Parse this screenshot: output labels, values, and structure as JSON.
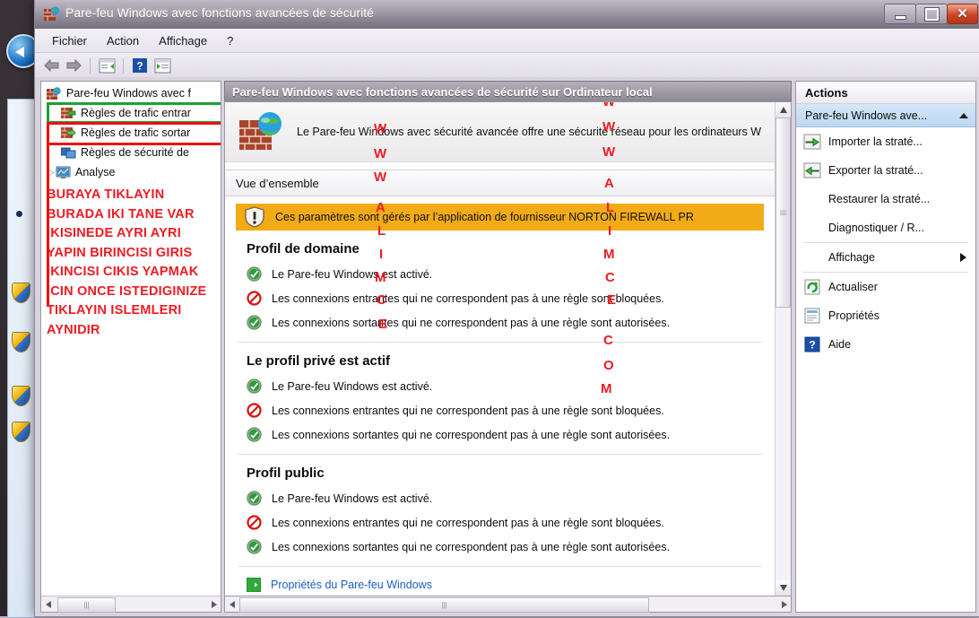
{
  "window": {
    "title": "Pare-feu Windows avec fonctions avancées de sécurité",
    "icon": "firewall-icon",
    "buttons": {
      "minimize": "–",
      "maximize": "□",
      "close": "✕"
    }
  },
  "menubar": {
    "items": [
      "Fichier",
      "Action",
      "Affichage",
      "?"
    ]
  },
  "toolbar": {
    "items": [
      {
        "name": "back-arrow-icon"
      },
      {
        "name": "forward-arrow-icon"
      },
      {
        "name": "show-hide-tree-icon"
      },
      {
        "name": "help-icon"
      },
      {
        "name": "show-hide-actions-icon"
      }
    ]
  },
  "tree": {
    "root": "Pare-feu Windows avec f",
    "items": [
      {
        "label": "Règles de trafic entrar",
        "icon": "inbound-rules-icon",
        "highlight": "green"
      },
      {
        "label": "Règles de trafic sortar",
        "icon": "outbound-rules-icon",
        "highlight": "red"
      },
      {
        "label": "Règles de sécurité de",
        "icon": "connection-security-icon",
        "highlight": "none"
      },
      {
        "label": "Analyse",
        "icon": "monitoring-icon",
        "highlight": "none",
        "expandable": true
      }
    ]
  },
  "annotation": {
    "color": "#ee1c23",
    "lines": [
      "BURAYA TIKLAYIN",
      "BURADA IKI TANE VAR",
      "IKISINEDE AYRI AYRI",
      "YAPIN BIRINCISI GIRIS",
      "IKINCISI CIKIS YAPMAK",
      "ICIN ONCE ISTEDIGINIZE",
      "TIKLAYIN ISLEMLERI",
      "AYNIDIR"
    ]
  },
  "watermark": {
    "color": "#ee1c23",
    "left_column": [
      "W",
      "W",
      "W",
      "A",
      "L",
      "I",
      "M",
      "C",
      "E"
    ],
    "right_column": [
      "W",
      "W",
      "W",
      "A",
      "L",
      "I",
      "M",
      "C",
      "E",
      "C",
      "O",
      "M"
    ]
  },
  "center": {
    "title": "Pare-feu Windows avec fonctions avancées de sécurité sur Ordinateur local",
    "banner_text": "Le Pare-feu Windows avec sécurité avancée offre une sécurité réseau pour les ordinateurs W",
    "banner_icon": "firewall-globe-icon",
    "overview_header": "Vue d’ensemble",
    "warning_icon": "warning-shield-icon",
    "warning_text": "Ces paramètres sont gérés par l’application de fournisseur NORTON FIREWALL PR",
    "profiles": [
      {
        "heading": "Profil de domaine",
        "rows": [
          {
            "icon": "check-icon",
            "text": "Le Pare-feu Windows est activé."
          },
          {
            "icon": "blocked-icon",
            "text": "Les connexions entrantes qui ne correspondent pas à une règle sont bloquées."
          },
          {
            "icon": "check-icon",
            "text": "Les connexions sortantes qui ne correspondent pas à une règle sont autorisées."
          }
        ]
      },
      {
        "heading": "Le profil privé est actif",
        "rows": [
          {
            "icon": "check-icon",
            "text": "Le Pare-feu Windows est activé."
          },
          {
            "icon": "blocked-icon",
            "text": "Les connexions entrantes qui ne correspondent pas à une règle sont bloquées."
          },
          {
            "icon": "check-icon",
            "text": "Les connexions sortantes qui ne correspondent pas à une règle sont autorisées."
          }
        ]
      },
      {
        "heading": "Profil public",
        "rows": [
          {
            "icon": "check-icon",
            "text": "Le Pare-feu Windows est activé."
          },
          {
            "icon": "blocked-icon",
            "text": "Les connexions entrantes qui ne correspondent pas à une règle sont bloquées."
          },
          {
            "icon": "check-icon",
            "text": "Les connexions sortantes qui ne correspondent pas à une règle sont autorisées."
          }
        ]
      }
    ],
    "link": {
      "icon": "properties-arrow-icon",
      "label": "Propriétés du Pare-feu Windows"
    }
  },
  "actions": {
    "title": "Actions",
    "group": "Pare-feu Windows ave...",
    "items": [
      {
        "label": "Importer la straté...",
        "icon": "import-icon"
      },
      {
        "label": "Exporter la straté...",
        "icon": "export-icon"
      },
      {
        "label": "Restaurer la straté...",
        "icon": "none"
      },
      {
        "label": "Diagnostiquer / R...",
        "icon": "none"
      },
      {
        "label": "Affichage",
        "icon": "none",
        "submenu": true
      },
      {
        "label": "Actualiser",
        "icon": "refresh-icon"
      },
      {
        "label": "Propriétés",
        "icon": "properties-icon"
      },
      {
        "label": "Aide",
        "icon": "help-icon"
      }
    ]
  }
}
